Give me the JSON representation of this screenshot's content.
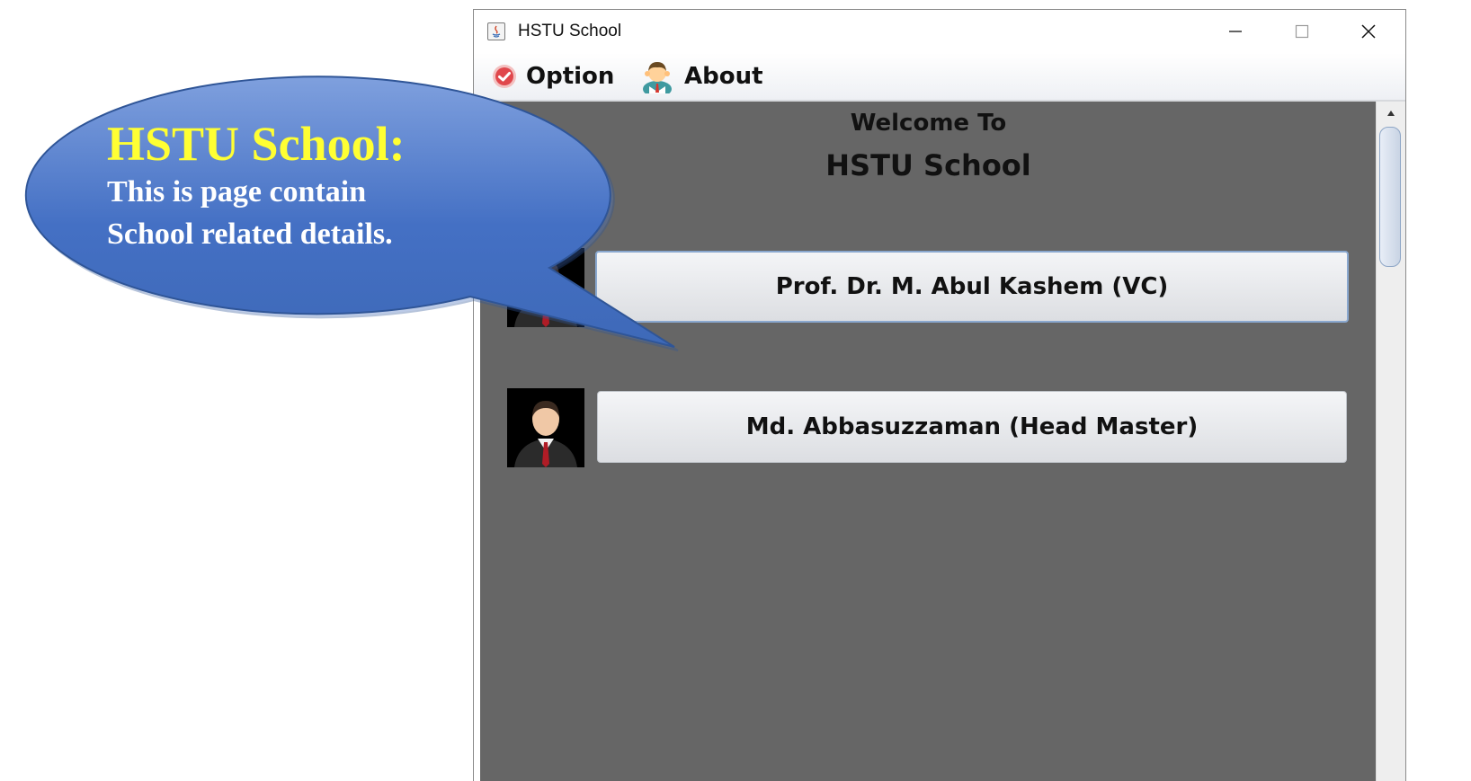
{
  "window": {
    "title": "HSTU School",
    "controls": [
      "minimize",
      "maximize",
      "close"
    ]
  },
  "menu": {
    "items": [
      {
        "label": "Option",
        "icon": "option-icon"
      },
      {
        "label": "About",
        "icon": "person-icon"
      }
    ]
  },
  "main": {
    "welcome": "Welcome To",
    "school": "HSTU School",
    "people": [
      {
        "label": "Prof. Dr. M. Abul Kashem (VC)",
        "icon": "person-avatar-icon"
      },
      {
        "label": "Md. Abbasuzzaman (Head Master)",
        "icon": "person-avatar-icon"
      }
    ]
  },
  "callout": {
    "title": "HSTU School:",
    "line1": "This is page contain",
    "line2": "School related details."
  },
  "colors": {
    "content_bg": "#666666",
    "callout_fill": "#4a74c6",
    "callout_title": "#ffff33",
    "callout_text": "#ffffff"
  }
}
